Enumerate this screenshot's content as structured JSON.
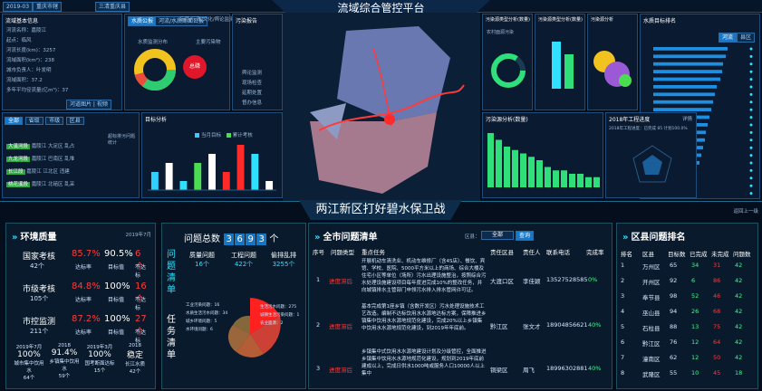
{
  "header": {
    "title": "流域综合管控平台",
    "left_tab": "2019-03",
    "left_tab2": "重庆市辖",
    "left_tab3": "三清重庆县"
  },
  "banner": {
    "title": "两江新区打好碧水保卫战",
    "right_link": "返回上一级"
  },
  "basin": {
    "title": "流域基本信息",
    "rows": [
      {
        "label": "河流名称：",
        "value": "嘉陵江"
      },
      {
        "label": "起点：",
        "value": "临风"
      },
      {
        "label": "河流长度(km)：",
        "value": "3257"
      },
      {
        "label": "流域面积(km²)：",
        "value": "238"
      },
      {
        "label": "城市负责人：",
        "value": "叶发明"
      },
      {
        "label": "流域面积：",
        "value": "37.2"
      },
      {
        "label": "多年平均径流量(亿m³)：",
        "value": "37"
      }
    ],
    "btn": "河道图片 | 视频"
  },
  "wq": {
    "tab_on": "水质公报",
    "tab_off": "河流/水质断面公报",
    "tabs": [
      "示范",
      "行政",
      "文化",
      "舆论监测"
    ],
    "pie_label": "水质监测分布",
    "circle_label": "主要污染物",
    "circle_value": "总磷",
    "legend": [
      "Ⅰ类",
      "Ⅱ类",
      "Ⅲ类",
      "Ⅳ类",
      "Ⅴ类",
      "劣Ⅴ类"
    ]
  },
  "notice": {
    "title": "污染报告",
    "items": [
      "舆论监测",
      "现场检查",
      "延期处置",
      "督办信息"
    ]
  },
  "rank_small": {
    "tabs": [
      "全部",
      "省级",
      "市级",
      "区县",
      "乡镇",
      "村级"
    ],
    "items": [
      {
        "badge": "大溪河段",
        "a": "嘉陵江",
        "b": "大足区",
        "c": "乱占"
      },
      {
        "badge": "九龙河段",
        "a": "嘉陵江",
        "b": "巴南区",
        "c": "乱堆"
      },
      {
        "badge": "长江段",
        "a": "嘉陵江",
        "b": "江北区",
        "c": "违建"
      },
      {
        "badge": "桃花溪段",
        "a": "嘉陵江",
        "b": "北碚区",
        "c": "乱采"
      }
    ],
    "side": "超标排污问题统计"
  },
  "mid_chart": {
    "title": "目标分析",
    "legend": [
      "当月目标",
      "累计考核"
    ],
    "values": [
      2,
      3,
      1,
      3,
      4,
      2,
      5,
      4,
      1
    ],
    "colors": [
      "#2fd0ff",
      "#ffffff",
      "#2fe0ff",
      "#4cdc52",
      "#ffffff",
      "#ff2a2a",
      "#ff2a2a",
      "#2fe0ff",
      "#ffffff"
    ]
  },
  "pollution": {
    "title": "污染源类型分析(数量)",
    "sub": "农村面源污染",
    "gauge_label": "工业源",
    "legend": [
      "工业污染",
      "农业",
      "生活污染",
      "其他"
    ]
  },
  "pollution2": {
    "title": "污染源类型分析(数量)",
    "legend": [
      "工业",
      "生活",
      "农村面源"
    ]
  },
  "pollution3": {
    "title": "污染源分析",
    "labels": [
      "大规模",
      "中规模",
      "小规模"
    ]
  },
  "ws_rank": {
    "title": "水质目标排名",
    "tabs": [
      "河流",
      "县区"
    ],
    "values": [
      82,
      80,
      77,
      76,
      74,
      70,
      68,
      66,
      64,
      62,
      60,
      58,
      57,
      55,
      53,
      51,
      48,
      44,
      40,
      36
    ]
  },
  "bar_month": {
    "title": "污染源分析(数量)",
    "values": [
      16,
      14,
      12,
      11,
      10,
      9,
      8,
      6,
      5,
      5,
      4,
      4,
      3,
      3
    ]
  },
  "engineering": {
    "title": "2018年工程进度",
    "link": "详情",
    "line1": "2018年工程进度：已完成 85 计划100.0%",
    "line2": "完成率 计划 实施 已完成 85%"
  },
  "env": {
    "title": "环境质量",
    "date": "2019年7月",
    "rows": [
      {
        "name": "国家考核",
        "cnt": "42个",
        "v1": "85.7%",
        "s1": "达标率",
        "v2": "90.5%",
        "s2": "目标值",
        "v3": "6个",
        "s3": "不达标"
      },
      {
        "name": "市级考核",
        "cnt": "105个",
        "v1": "84.8%",
        "s1": "达标率",
        "v2": "100%",
        "s2": "目标值",
        "v3": "16个",
        "s3": "不达标"
      },
      {
        "name": "市控监测",
        "cnt": "211个",
        "v1": "87.2%",
        "s1": "达标率",
        "v2": "100%",
        "s2": "目标值",
        "v3": "27个",
        "s3": "不达标"
      }
    ],
    "bottom": [
      {
        "year": "2019年7月",
        "val": "100%",
        "lbl": "城市集中饮用水",
        "sub": "64个"
      },
      {
        "year": "2018",
        "val": "91.4%",
        "lbl": "乡镇集中饮用水",
        "sub": "59个"
      },
      {
        "year": "2019年3月",
        "val": "100%",
        "lbl": "国考断面达标",
        "sub": "15个"
      },
      {
        "year": "2018",
        "val": "稳定",
        "lbl": "长江水质",
        "sub": "42个"
      }
    ]
  },
  "issues": {
    "tab1": "问题清单",
    "tab2": "任务清单",
    "total_label": "问题总数",
    "total_digits": [
      "3",
      "6",
      "9",
      "3"
    ],
    "total_unit": "个",
    "kpis": [
      {
        "label": "质量问题",
        "val": "16个"
      },
      {
        "label": "工程问题",
        "val": "422个"
      },
      {
        "label": "偷排乱排",
        "val": "3255个"
      }
    ],
    "rose_labels": [
      "工业污染问题：16",
      "生活污水问题：275",
      "城镇生活污染问题：1",
      "水质生活污水问题：34",
      "城乡环境问题：5",
      "水环境问题：6",
      "农业面源：2"
    ]
  },
  "citywide": {
    "title": "全市问题清单",
    "district_label": "区县：",
    "district_value": "全部",
    "btn": "查询",
    "headers": [
      "序号",
      "问题类型",
      "重点任务",
      "责任区县",
      "责任人",
      "联系电话",
      "完成率"
    ],
    "rows": [
      {
        "no": "1",
        "type": "进度滞后",
        "task": "开展机动车清洗业、机动车维修厂（含4S店）、餐饮、宾馆、学校、医院、5000平方米以上的商场、综合大楼及住宅小区等单位（场所）污水出理设施整治，按照综合污水处理设施建设项目每年度进完成10%的整改任务，并向城镇排水主管部门申领污水排入排水管网许可证。",
        "dist": "大渡口区",
        "person": "李佳颖",
        "phone": "13527528585",
        "rate": "0%"
      },
      {
        "no": "2",
        "type": "进度滞后",
        "task": "基本完成第1座乡镇（含数开发区）污水处理设施技术工艺改造。编制不达标饮用水水源地达标方案，保障推进乡镇集中饮用水水源地规范化建设，完成20%以上乡镇集中饮用水水源地规范化建设，到2019年年底前。",
        "dist": "黔江区",
        "person": "张文才",
        "phone": "18904856621",
        "rate": "40%"
      },
      {
        "no": "3",
        "type": "进度滞后",
        "task": "乡镇集中式饮用水水源地建设计划及分级管控，全面推进乡镇集中饮用水水源地规范化建设，规划到2019年底前建成以上，完成日供水1000吨或服务人口10000人以上集中",
        "dist": "铜梁区",
        "person": "周飞",
        "phone": "18996302881",
        "rate": "40%"
      }
    ]
  },
  "district_rank": {
    "title": "区县问题排名",
    "headers": [
      "排名",
      "区县",
      "目标数",
      "已完成",
      "未完成",
      "问题数"
    ],
    "rows": [
      {
        "r": "1",
        "n": "万州区",
        "t": "65",
        "d": "34",
        "u": "31",
        "q": "42"
      },
      {
        "r": "2",
        "n": "开州区",
        "t": "92",
        "d": "6",
        "u": "86",
        "q": "42"
      },
      {
        "r": "3",
        "n": "奉节县",
        "t": "98",
        "d": "52",
        "u": "46",
        "q": "42"
      },
      {
        "r": "4",
        "n": "巫山县",
        "t": "94",
        "d": "26",
        "u": "68",
        "q": "42"
      },
      {
        "r": "5",
        "n": "石柱县",
        "t": "88",
        "d": "13",
        "u": "75",
        "q": "42"
      },
      {
        "r": "6",
        "n": "黔江区",
        "t": "76",
        "d": "12",
        "u": "64",
        "q": "42"
      },
      {
        "r": "7",
        "n": "潼南区",
        "t": "62",
        "d": "12",
        "u": "50",
        "q": "42"
      },
      {
        "r": "8",
        "n": "武隆区",
        "t": "55",
        "d": "10",
        "u": "45",
        "q": "18"
      }
    ]
  }
}
